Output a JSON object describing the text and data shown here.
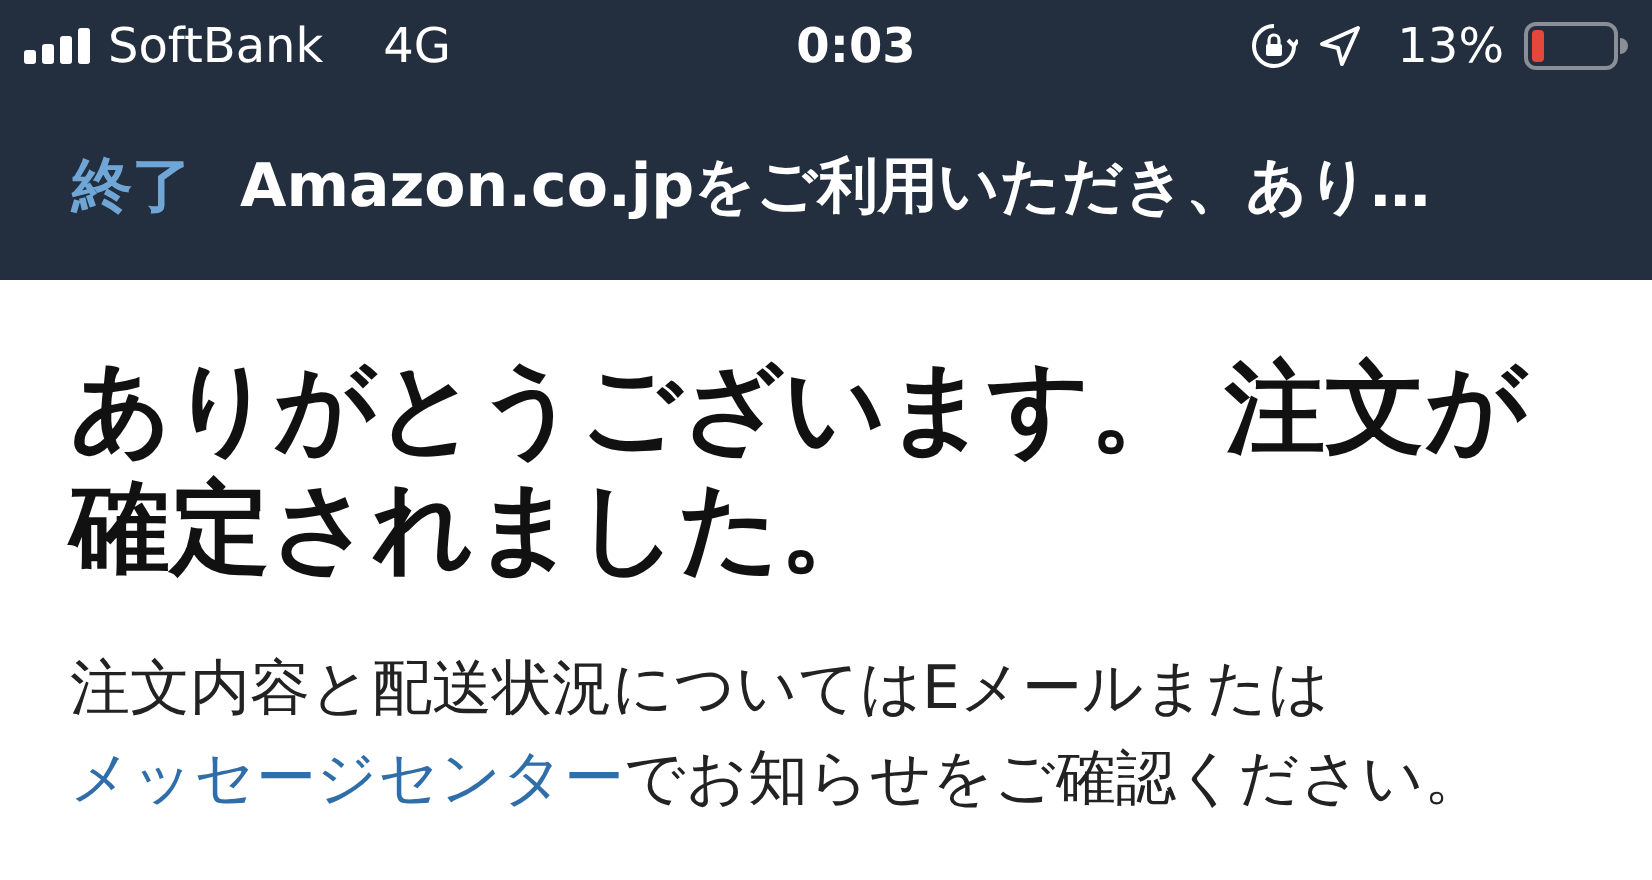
{
  "status_bar": {
    "carrier": "SoftBank",
    "network": "4G",
    "time": "0:03",
    "battery_percent": "13%"
  },
  "nav_bar": {
    "done_button": "終了",
    "title": "Amazon.co.jpをご利用いただき、あり…"
  },
  "heading": "ありがとうございます。 注文が確定されました。",
  "message": {
    "before": "注文内容と配送状況についてはEメールまたは",
    "link": "メッセージセンター",
    "after": "でお知らせをご確認ください。"
  }
}
